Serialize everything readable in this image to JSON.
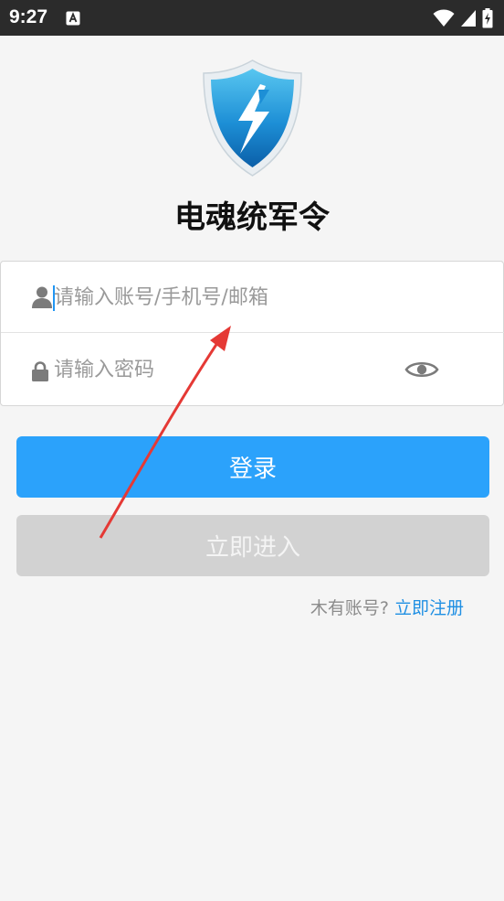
{
  "status_bar": {
    "time": "9:27",
    "notification_icon": "text-a-icon",
    "icons": [
      "wifi-icon",
      "signal-icon",
      "battery-charging-icon"
    ]
  },
  "app": {
    "logo_icon": "shield-lightning-icon",
    "title": "电魂统军令"
  },
  "login_form": {
    "account_icon": "user-icon",
    "account_placeholder": "请输入账号/手机号/邮箱",
    "account_value": "",
    "password_icon": "lock-icon",
    "password_placeholder": "请输入密码",
    "password_value": "",
    "toggle_visibility_icon": "eye-icon"
  },
  "buttons": {
    "login_label": "登录",
    "enter_label": "立即进入"
  },
  "register": {
    "prompt": "木有账号?",
    "link": "立即注册"
  },
  "colors": {
    "primary": "#2ba2fb",
    "disabled": "#d2d2d2",
    "link": "#1f8fe3",
    "annotation_arrow": "#e53935"
  }
}
